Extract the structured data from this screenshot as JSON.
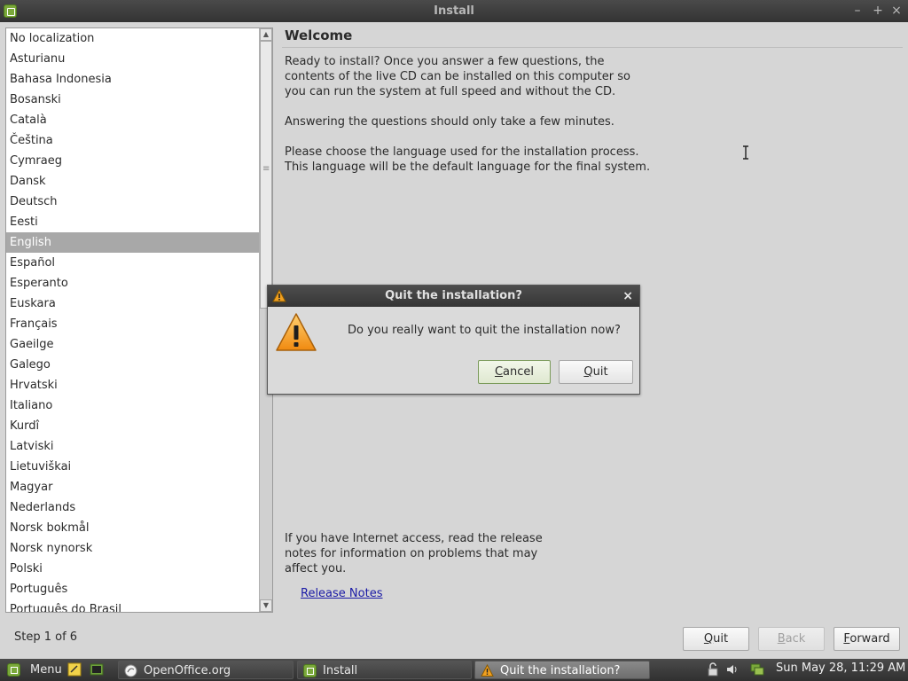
{
  "window": {
    "title": "Install",
    "controls": {
      "minimize": "–",
      "maximize": "+",
      "close": "×"
    }
  },
  "languages": {
    "items": [
      "No localization",
      "Asturianu",
      "Bahasa Indonesia",
      "Bosanski",
      "Català",
      "Čeština",
      "Cymraeg",
      "Dansk",
      "Deutsch",
      "Eesti",
      "English",
      "Español",
      "Esperanto",
      "Euskara",
      "Français",
      "Gaeilge",
      "Galego",
      "Hrvatski",
      "Italiano",
      "Kurdî",
      "Latviski",
      "Lietuviškai",
      "Magyar",
      "Nederlands",
      "Norsk bokmål",
      "Norsk nynorsk",
      "Polski",
      "Português",
      "Português do Brasil"
    ],
    "selected": "English"
  },
  "welcome": {
    "heading": "Welcome",
    "p1_line1": "Ready to install? Once you answer a few questions, the",
    "p1_line2": "contents of the live CD can be installed on this computer so",
    "p1_line3": "you can run the system at full speed and without the CD.",
    "p2": "Answering the questions should only take a few minutes.",
    "p3_line1": "Please choose the language used for the installation process.",
    "p3_line2": "This language will be the default language for the final system.",
    "p4_line1": "If you have Internet access, read the release",
    "p4_line2": "notes for information on problems that may",
    "p4_line3": "affect you.",
    "release_notes_link": "Release Notes"
  },
  "footer": {
    "step": "Step 1 of 6",
    "quit_mnemonic": "Q",
    "quit_rest": "uit",
    "back_mnemonic": "B",
    "back_rest": "ack",
    "forward_mnemonic": "F",
    "forward_rest": "orward"
  },
  "dialog": {
    "title": "Quit the installation?",
    "close": "×",
    "message": "Do you really want to quit the installation now?",
    "cancel_mnemonic": "C",
    "cancel_rest": "ancel",
    "quit_mnemonic": "Q",
    "quit_rest": "uit"
  },
  "taskbar": {
    "menu_label": "Menu",
    "tasks": [
      "OpenOffice.org",
      "Install",
      "Quit the installation?"
    ],
    "clock": "Sun May 28, 11:29 AM"
  },
  "colors": {
    "selection": "#a8a8a8",
    "link": "#1a1aa6",
    "warning": "#f0a020"
  }
}
